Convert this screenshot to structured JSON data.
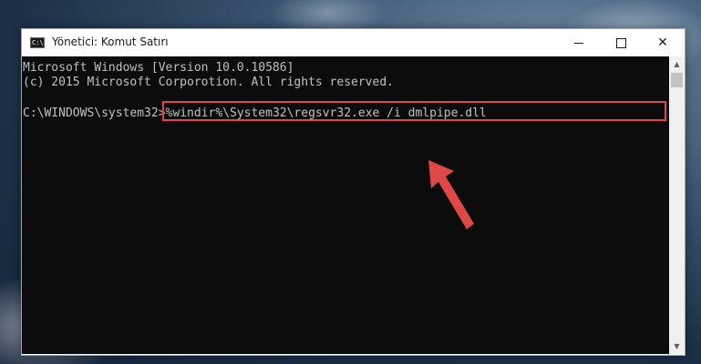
{
  "window": {
    "title": "Yönetici: Komut Satırı",
    "icon": "C:\\",
    "app_icon_name": "command-prompt-icon"
  },
  "controls": {
    "close_glyph": "✕"
  },
  "console": {
    "lines": [
      "Microsoft Windows [Version 10.0.10586]",
      "(c) 2015 Microsoft Corporotion. All rights reserved."
    ],
    "prompt": "C:\\WINDOWS\\system32>",
    "command": "%windir%\\System32\\regsvr32.exe /i dmlpipe.dll"
  },
  "scrollbar": {
    "up_glyph": "▲",
    "down_glyph": "▼"
  },
  "colors": {
    "console_bg": "#0c0c0c",
    "console_text": "#c0c0c0",
    "highlight": "#e04848"
  }
}
